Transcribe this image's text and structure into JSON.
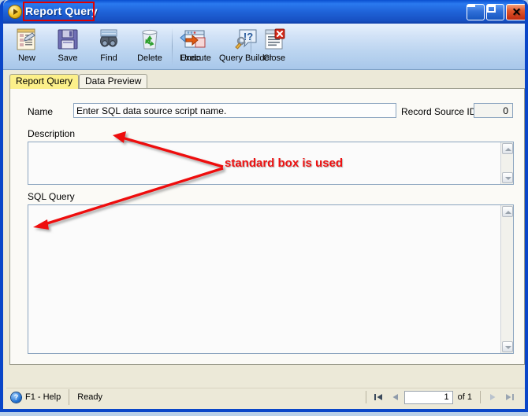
{
  "window": {
    "title": "Report Query",
    "icon": "play-circle-icon",
    "buttons": {
      "minimize": "minimize-button",
      "maximize": "maximize-button",
      "close_glyph": "✕"
    }
  },
  "toolbar": {
    "items": [
      {
        "label": "New",
        "icon": "new-document-icon"
      },
      {
        "label": "Save",
        "icon": "floppy-disk-icon"
      },
      {
        "label": "Find",
        "icon": "binoculars-icon"
      },
      {
        "label": "Delete",
        "icon": "recycle-bin-icon"
      },
      {
        "label": "Undo",
        "icon": "undo-arrow-icon"
      },
      {
        "label": "Execute",
        "icon": "execute-window-icon"
      },
      {
        "label": "Query Builder",
        "icon": "query-builder-icon"
      },
      {
        "label": "Close",
        "icon": "close-document-icon"
      }
    ]
  },
  "tabs": [
    {
      "label": "Report Query",
      "active": true
    },
    {
      "label": "Data Preview",
      "active": false
    }
  ],
  "form": {
    "name_label": "Name",
    "name_value": "Enter SQL data source script name.",
    "record_source_id_label": "Record Source ID",
    "record_source_id_value": "0",
    "description_label": "Description",
    "description_value": "",
    "sql_query_label": "SQL Query",
    "sql_query_value": ""
  },
  "statusbar": {
    "help_icon": "help-question-icon",
    "help_text": "F1 - Help",
    "status_text": "Ready"
  },
  "navigator": {
    "first_icon": "first-record-icon",
    "prev_icon": "previous-record-icon",
    "page_value": "1",
    "of_text": "of  1",
    "next_icon": "next-record-icon",
    "last_icon": "last-record-icon"
  },
  "annotations": {
    "callout_text": "standard box is used",
    "callout_color": "#ee1111",
    "title_highlight_color": "#e00000",
    "tab_highlight_color": "#fcf08a"
  }
}
